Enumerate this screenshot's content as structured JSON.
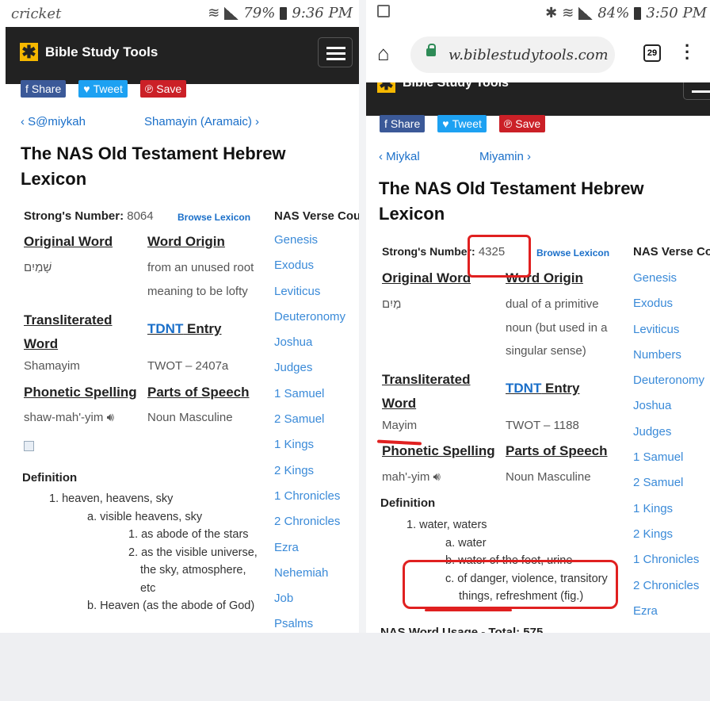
{
  "left": {
    "status": {
      "carrier": "cricket",
      "battery": "79%",
      "time": "9:36 PM"
    },
    "site": {
      "logo": "Bible Study Tools"
    },
    "share": {
      "share": "Share",
      "tweet": "Tweet",
      "save": "Save"
    },
    "nav": {
      "prev": "‹ S@miykah",
      "next": "Shamayin (Aramaic) ›"
    },
    "title_line1": "The NAS Old Testament Hebrew",
    "title_line2": "Lexicon",
    "lexicon": {
      "strongs_label": "Strong's Number:",
      "strongs_value": "8064",
      "browse": "Browse Lexicon",
      "verse_count": "NAS Verse Cou",
      "original_word_label": "Original Word",
      "original_word": "שָׁמַיִם",
      "word_origin_label": "Word Origin",
      "word_origin_1": "from an unused root",
      "word_origin_2": "meaning to be lofty",
      "translit_label_1": "Transliterated",
      "translit_label_2": "Word",
      "tdnt_link": "TDNT",
      "tdnt_rest": " Entry",
      "translit": "Shamayim",
      "twot": "TWOT – 2407a",
      "phonetic_label": "Phonetic Spelling",
      "pos_label": "Parts of Speech",
      "phonetic": "shaw-mah'-yim",
      "pos": "Noun Masculine",
      "definition_label": "Definition"
    },
    "books": [
      "Genesis",
      "Exodus",
      "Leviticus",
      "Deuteronomy",
      "Joshua",
      "Judges",
      "1 Samuel",
      "2 Samuel",
      "1 Kings",
      "2 Kings",
      "1 Chronicles",
      "2 Chronicles",
      "Ezra",
      "Nehemiah",
      "Job",
      "Psalms"
    ],
    "definition": [
      "1. heaven, heavens, sky",
      "a. visible heavens, sky",
      "1. as abode of the stars",
      "2. as the visible universe,",
      "the sky, atmosphere,",
      "etc",
      "b. Heaven (as the abode of God)"
    ]
  },
  "right": {
    "status": {
      "battery": "84%",
      "time": "3:50 PM"
    },
    "chrome": {
      "url": "w.biblestudytools.com",
      "tabs": "29"
    },
    "site": {
      "logo": "Bible Study Tools"
    },
    "share": {
      "share": "Share",
      "tweet": "Tweet",
      "save": "Save"
    },
    "nav": {
      "prev": "‹ Miykal",
      "next": "Miyamin ›"
    },
    "title_line1": "The NAS Old Testament Hebrew",
    "title_line2": "Lexicon",
    "lexicon": {
      "strongs_label": "Strong's Number:",
      "strongs_value": "4325",
      "browse": "Browse Lexicon",
      "verse_count": "NAS Verse Co",
      "original_word_label": "Original Word",
      "original_word": "מַיִם",
      "word_origin_label": "Word Origin",
      "word_origin_1": "dual of a primitive",
      "word_origin_2": "noun (but used in a",
      "word_origin_3": "singular sense)",
      "translit_label_1": "Transliterated",
      "translit_label_2": "Word",
      "tdnt_link": "TDNT",
      "tdnt_rest": " Entry",
      "translit": "Mayim",
      "twot": "TWOT – 1188",
      "phonetic_label": "Phonetic Spelling",
      "pos_label": "Parts of Speech",
      "phonetic": "mah'-yim",
      "pos": "Noun Masculine",
      "definition_label": "Definition",
      "usage": "NAS Word Usage - Total: 575"
    },
    "books": [
      "Genesis",
      "Exodus",
      "Leviticus",
      "Numbers",
      "Deuteronomy",
      "Joshua",
      "Judges",
      "1 Samuel",
      "2 Samuel",
      "1 Kings",
      "2 Kings",
      "1 Chronicles",
      "2 Chronicles",
      "Ezra"
    ],
    "definition": [
      "1. water, waters",
      "a. water",
      "b. water of the feet, urine",
      "c. of danger, violence, transitory",
      "things, refreshment (fig.)"
    ]
  },
  "colors": {
    "link": "#1a6fc9",
    "annotation": "#e02020",
    "logo": "#f6b800",
    "header_bar": "#222222"
  }
}
